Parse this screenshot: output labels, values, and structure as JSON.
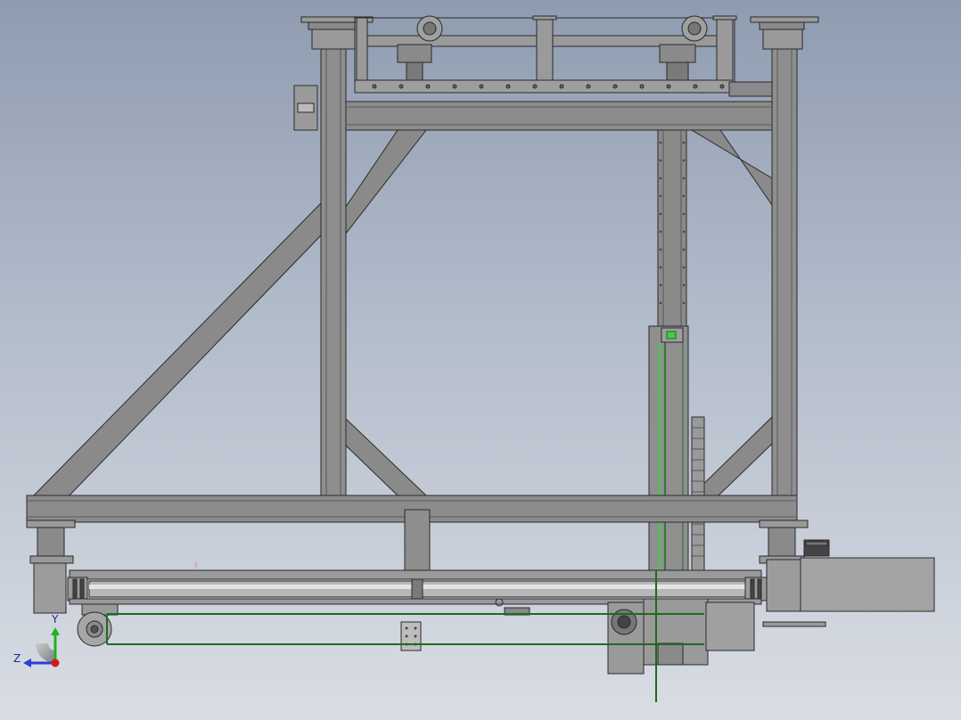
{
  "viewport": {
    "background_top": "#8f9cb0",
    "background_bottom": "#d9dde4"
  },
  "model": {
    "steel_color": "#8c8c8c",
    "steel_edge_color": "#2a2a2a",
    "cable_color": "#1f6b1f",
    "highlight_color": "#3fd13f"
  },
  "triad": {
    "y_label": "Y",
    "z_label": "Z",
    "y_color": "#1db31d",
    "z_color": "#2a3fd6",
    "x_color": "#d11a1a"
  }
}
